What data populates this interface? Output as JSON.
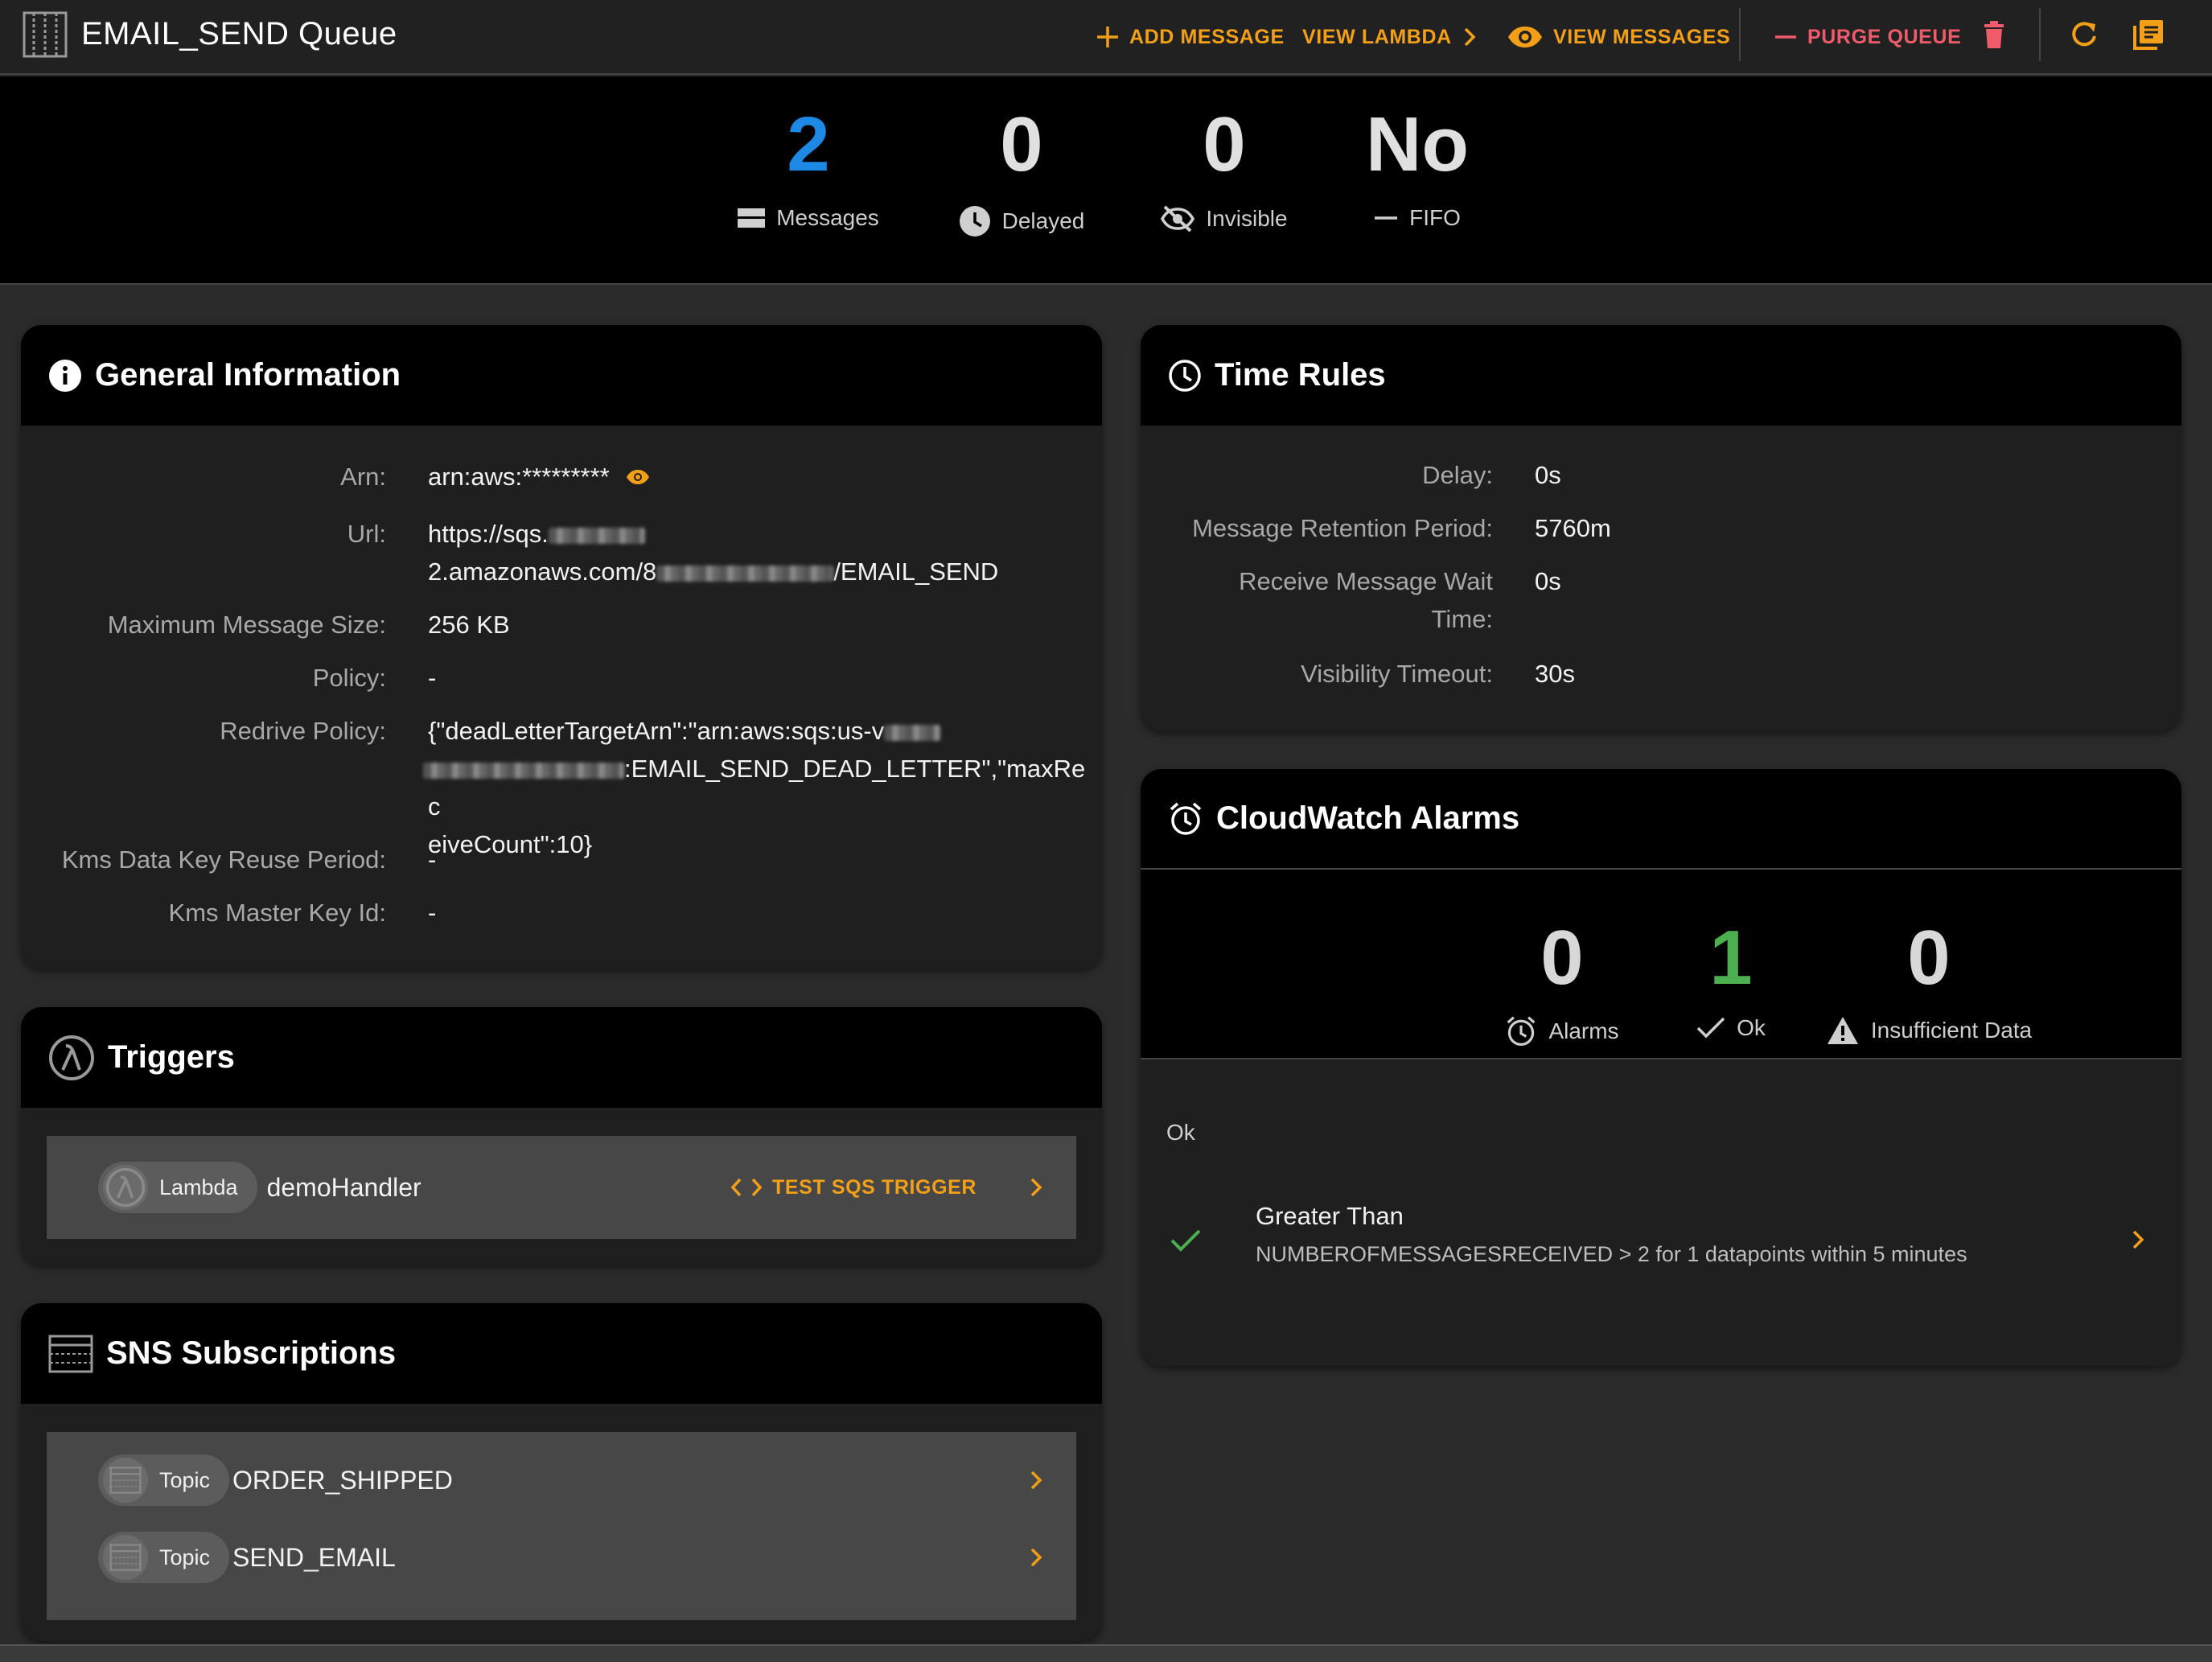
{
  "header": {
    "title": "EMAIL_SEND Queue",
    "actions": {
      "add_message": "ADD MESSAGE",
      "view_lambda": "VIEW LAMBDA",
      "view_messages": "VIEW MESSAGES",
      "purge_queue": "PURGE QUEUE"
    }
  },
  "stats": [
    {
      "value": "2",
      "label": "Messages",
      "icon": "list-icon"
    },
    {
      "value": "0",
      "label": "Delayed",
      "icon": "clock-icon"
    },
    {
      "value": "0",
      "label": "Invisible",
      "icon": "eye-off-icon"
    },
    {
      "value": "No",
      "label": "FIFO",
      "icon": "minus-icon"
    }
  ],
  "general": {
    "title": "General Information",
    "fields": {
      "arn": {
        "label": "Arn:",
        "value": "arn:aws:*********"
      },
      "url": {
        "label": "Url:",
        "value_part1": "https://sqs.",
        "value_part2": "2.amazonaws.com/8",
        "value_part3": "/EMAIL_SEND"
      },
      "max_size": {
        "label": "Maximum Message Size:",
        "value": "256 KB"
      },
      "policy": {
        "label": "Policy:",
        "value": "-"
      },
      "redrive": {
        "label": "Redrive Policy:",
        "value_part1": "{\"deadLetterTargetArn\":\"arn:aws:sqs:us-v",
        "value_part2": ":EMAIL_SEND_DEAD_LETTER\",\"maxRec",
        "value_part3": "eiveCount\":10}"
      },
      "kms_reuse": {
        "label": "Kms Data Key Reuse Period:",
        "value": "-"
      },
      "kms_key": {
        "label": "Kms Master Key Id:",
        "value": "-"
      }
    }
  },
  "triggers": {
    "title": "Triggers",
    "items": [
      {
        "chip": "Lambda",
        "name": "demoHandler",
        "action": "TEST SQS TRIGGER"
      }
    ]
  },
  "sns": {
    "title": "SNS Subscriptions",
    "items": [
      {
        "chip": "Topic",
        "name": "ORDER_SHIPPED"
      },
      {
        "chip": "Topic",
        "name": "SEND_EMAIL"
      }
    ]
  },
  "time_rules": {
    "title": "Time Rules",
    "fields": {
      "delay": {
        "label": "Delay:",
        "value": "0s"
      },
      "retention": {
        "label": "Message Retention Period:",
        "value": "5760m"
      },
      "wait_1": {
        "label": "Receive Message Wait",
        "value": "0s"
      },
      "wait_2": {
        "label": "Time:"
      },
      "visibility": {
        "label": "Visibility Timeout:",
        "value": "30s"
      }
    }
  },
  "cloudwatch": {
    "title": "CloudWatch Alarms",
    "stats": [
      {
        "value": "0",
        "label": "Alarms"
      },
      {
        "value": "1",
        "label": "Ok"
      },
      {
        "value": "0",
        "label": "Insufficient Data"
      }
    ],
    "section_label": "Ok",
    "alarm": {
      "title": "Greater Than",
      "description": "NUMBEROFMESSAGESRECEIVED > 2 for 1 datapoints within 5 minutes"
    }
  },
  "colors": {
    "accent": "#f3a018",
    "danger": "#ef5b6a",
    "blue": "#1e88e5",
    "green": "#4caf50"
  }
}
